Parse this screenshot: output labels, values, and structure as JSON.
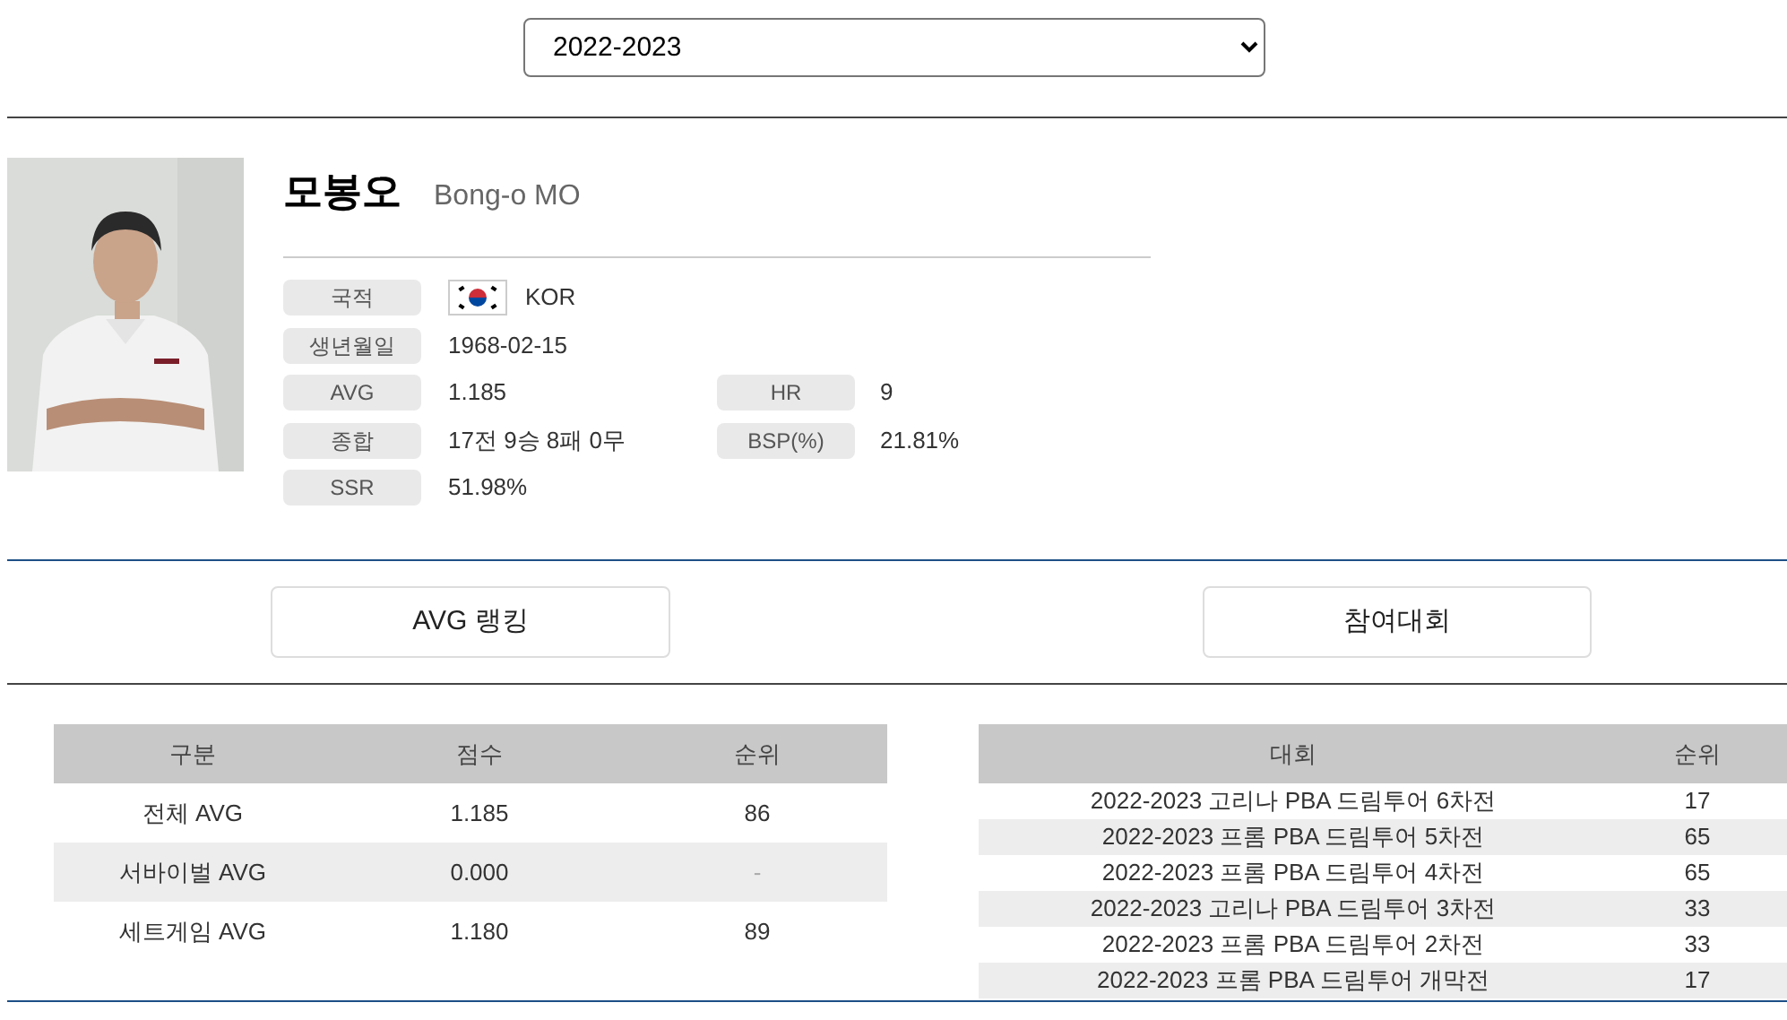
{
  "season_select": {
    "value": "2022-2023"
  },
  "player": {
    "name": "모봉오",
    "name_en": "Bong-o MO",
    "info": [
      {
        "label": "국적",
        "value": "KOR",
        "kind": "flag"
      },
      {
        "label": "생년월일",
        "value": "1968-02-15"
      },
      {
        "label": "AVG",
        "value": "1.185",
        "label2": "HR",
        "value2": "9"
      },
      {
        "label": "종합",
        "value": "17전 9승 8패 0무",
        "label2": "BSP(%)",
        "value2": "21.81%"
      },
      {
        "label": "SSR",
        "value": "51.98%"
      }
    ]
  },
  "section_buttons": [
    "AVG 랭킹",
    "참여대회"
  ],
  "avg_table": {
    "columns": [
      "구분",
      "점수",
      "순위"
    ],
    "rows": [
      [
        "전체 AVG",
        "1.185",
        "86"
      ],
      [
        "서바이벌 AVG",
        "0.000",
        "-"
      ],
      [
        "세트게임 AVG",
        "1.180",
        "89"
      ]
    ]
  },
  "tournament_table": {
    "columns": [
      "대회",
      "순위"
    ],
    "rows": [
      [
        "2022-2023 고리나 PBA 드림투어 6차전",
        "17"
      ],
      [
        "2022-2023 프롬 PBA 드림투어 5차전",
        "65"
      ],
      [
        "2022-2023 프롬 PBA 드림투어 4차전",
        "65"
      ],
      [
        "2022-2023 고리나 PBA 드림투어 3차전",
        "33"
      ],
      [
        "2022-2023 프롬 PBA 드림투어 2차전",
        "33"
      ],
      [
        "2022-2023 프롬 PBA 드림투어 개막전",
        "17"
      ]
    ]
  }
}
